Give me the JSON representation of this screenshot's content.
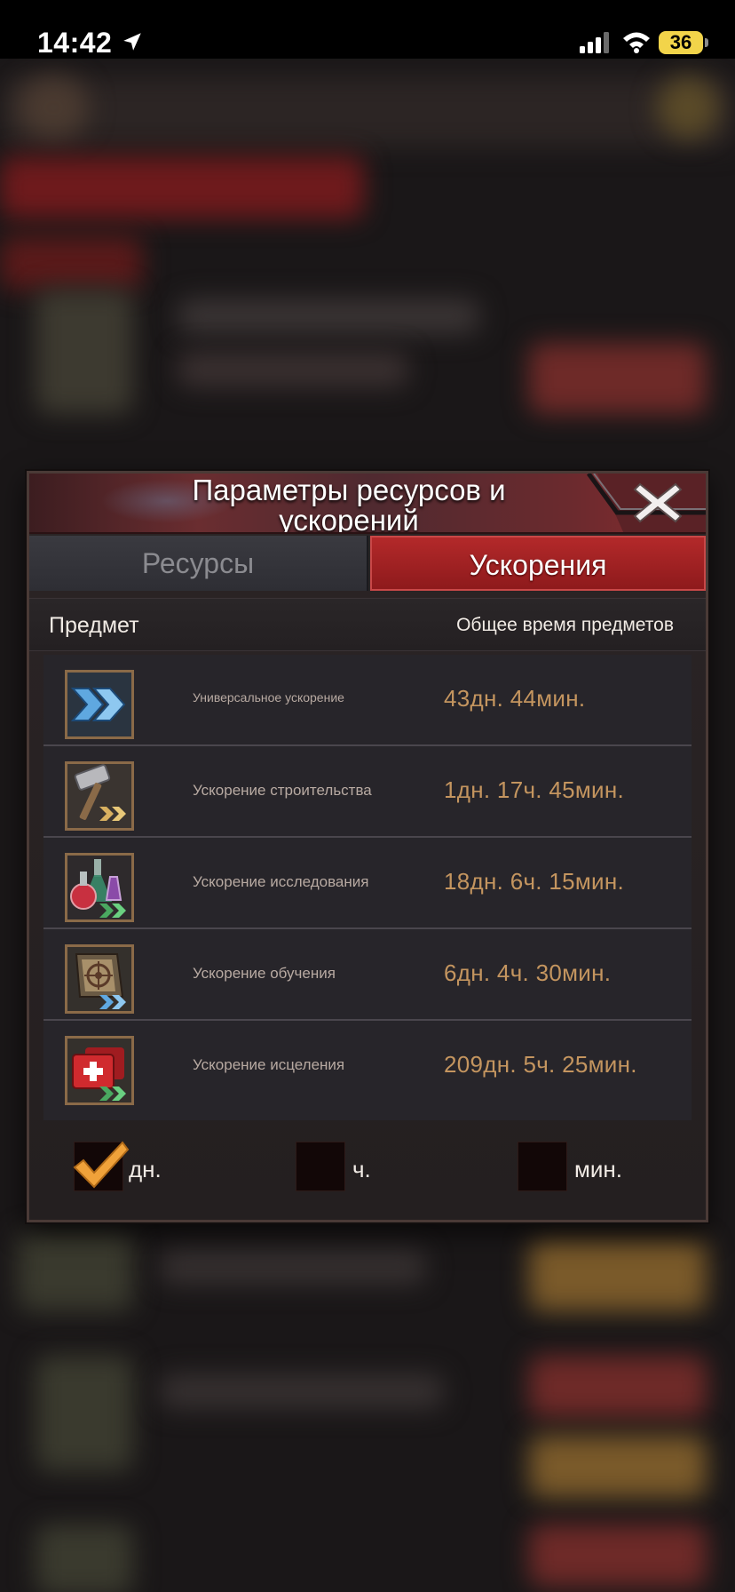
{
  "status_bar": {
    "time": "14:42",
    "battery_level": "36",
    "icons": [
      "location-arrow-icon",
      "signal-icon",
      "wifi-icon",
      "battery-icon"
    ]
  },
  "dialog": {
    "title": "Параметры ресурсов и ускорений",
    "tabs": [
      {
        "label": "Ресурсы",
        "active": false
      },
      {
        "label": "Ускорения",
        "active": true
      }
    ],
    "columns": {
      "item": "Предмет",
      "total_time": "Общее время предметов"
    },
    "rows": [
      {
        "icon": "universal-speedup-icon",
        "name": "Универсальное ускорение",
        "time": "43дн. 44мин."
      },
      {
        "icon": "construction-speedup-icon",
        "name": "Ускорение строительства",
        "time": "1дн. 17ч. 45мин."
      },
      {
        "icon": "research-speedup-icon",
        "name": "Ускорение исследования",
        "time": "18дн. 6ч. 15мин."
      },
      {
        "icon": "training-speedup-icon",
        "name": "Ускорение обучения",
        "time": "6дн. 4ч. 30мин."
      },
      {
        "icon": "healing-speedup-icon",
        "name": "Ускорение исцеления",
        "time": "209дн. 5ч. 25мин."
      }
    ],
    "units": [
      {
        "label": "дн.",
        "checked": true
      },
      {
        "label": "ч.",
        "checked": false
      },
      {
        "label": "мин.",
        "checked": false
      }
    ]
  },
  "colors": {
    "accent_red": "#9e2224",
    "time_gold": "#c4955f",
    "check_orange": "#f0a23a"
  }
}
